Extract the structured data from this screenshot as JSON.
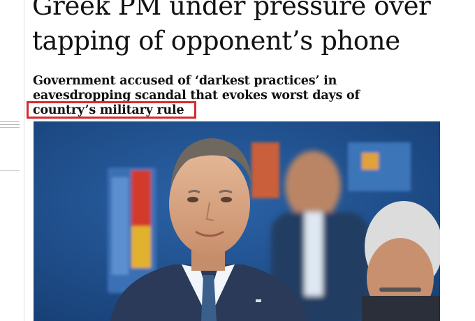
{
  "article": {
    "headline_lines": [
      "Greek PM under pressure over",
      "tapping of opponent’s phone"
    ],
    "standfirst_lines": [
      "Government accused of ‘darkest practices’ in",
      "eavesdropping scandal that evokes worst days of",
      "country’s military rule"
    ]
  },
  "annotation": {
    "color": "#d62b2b"
  },
  "photo": {
    "subject": "man-in-suit-smiling",
    "background_color": "#1f4f8f"
  },
  "icons": {
    "menu": "hamburger-icon"
  }
}
